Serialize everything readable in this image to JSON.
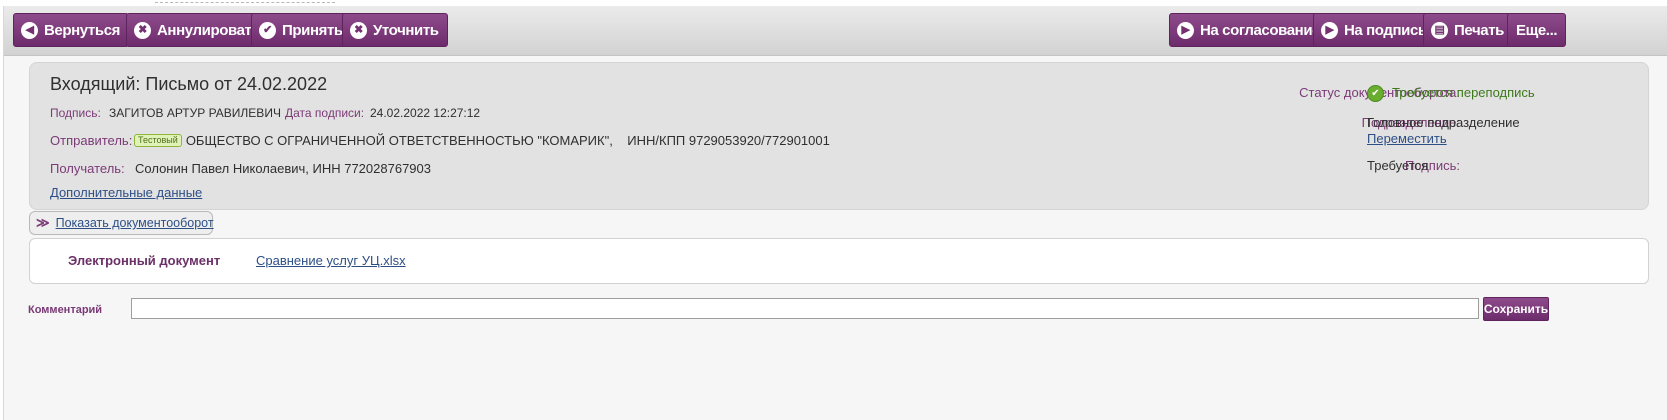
{
  "toolbar": {
    "back": "Вернуться",
    "cancel": "Аннулировать",
    "accept": "Принять",
    "clarify": "Уточнить",
    "to_approval": "На согласование",
    "to_sign": "На подпись",
    "print": "Печать",
    "more": "Еще..."
  },
  "document": {
    "title": "Входящий: Письмо от 24.02.2022",
    "sign_label": "Подпись:",
    "signer": "ЗАГИТОВ АРТУР РАВИЛЕВИЧ",
    "sign_date_label": "Дата подписи:",
    "sign_date": "24.02.2022 12:27:12",
    "sender_label": "Отправитель:",
    "sender_badge": "Тестовый",
    "sender": "ОБЩЕСТВО С ОГРАНИЧЕННОЙ ОТВЕТСТВЕННОСТЬЮ \"КОМАРИК\",    ИНН/КПП 9729053920/772901001",
    "recipient_label": "Получатель:",
    "recipient": "Солонин Павел Николаевич, ИНН 772028767903",
    "extra_link": "Дополнительные данные"
  },
  "status": {
    "workflow_label": "Статус документооборота:",
    "workflow_value": "Требуется переподпись",
    "workflow_color": "#3c7a1a",
    "division_label": "Подразделение:",
    "division_value": "Головное подразделение",
    "move_link": "Переместить",
    "signature_label": "Подпись:",
    "signature_value": "Требуется"
  },
  "toggle": {
    "label": "Показать документооборот"
  },
  "files": {
    "type_label": "Электронный документ",
    "file_name": "Сравнение услуг УЦ.xlsx"
  },
  "comment": {
    "label": "Комментарий",
    "value": "",
    "placeholder": "",
    "save": "Сохранить"
  },
  "colors": {
    "accent": "#7a3a76",
    "link": "#2d4f86"
  }
}
